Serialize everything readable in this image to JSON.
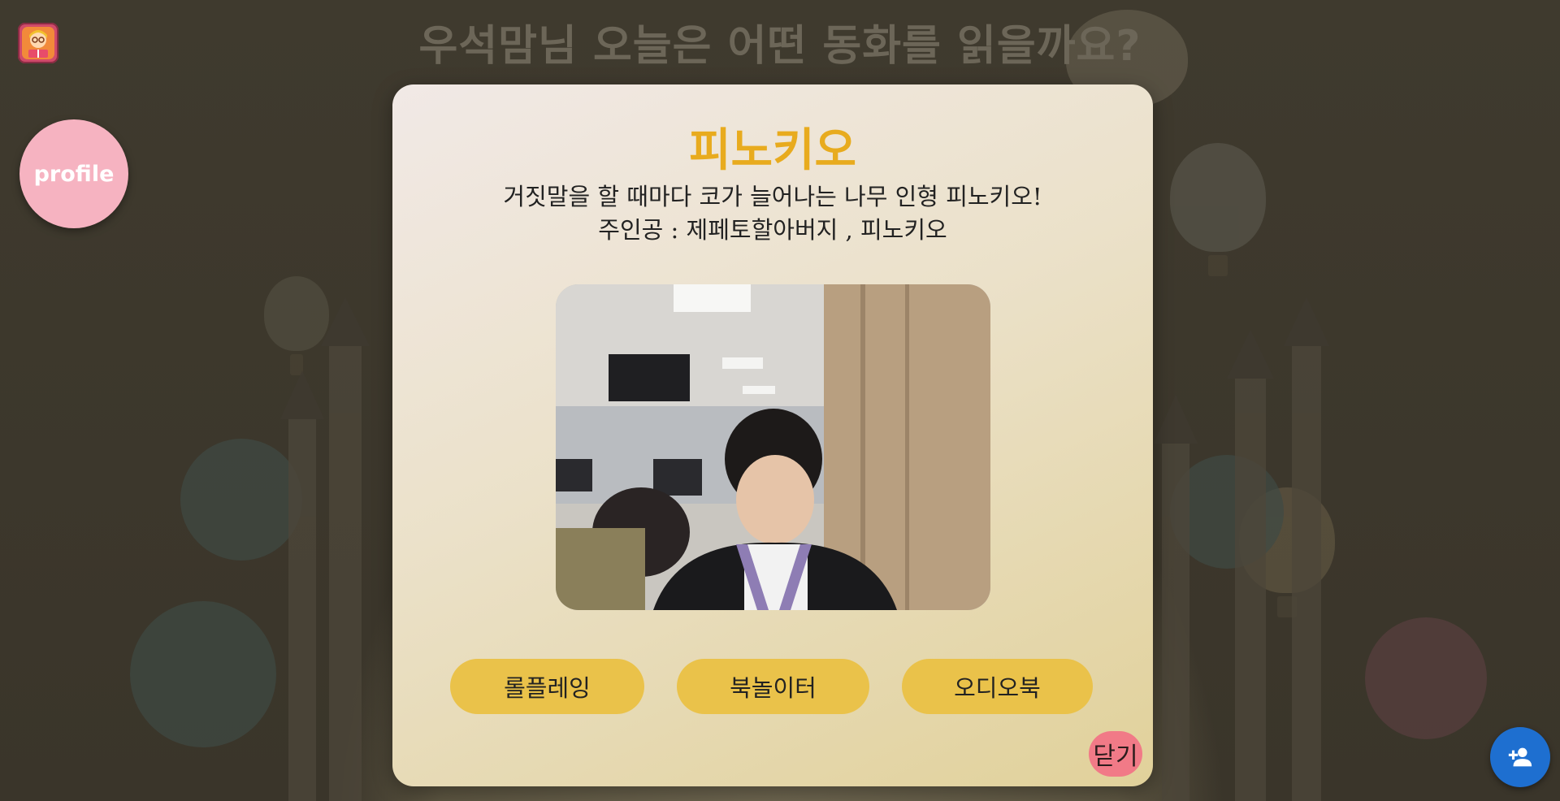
{
  "background": {
    "title": "우석맘님 오늘은 어떤 동화를 읽을까요?"
  },
  "sidebar": {
    "app_icon": "reading-girl-icon",
    "profile_label": "profile"
  },
  "modal": {
    "title": "피노키오",
    "description_line1": "거짓말을 할 때마다 코가 늘어나는 나무 인형 피노키오!",
    "description_line2": "주인공 : 제페토할아버지 , 피노키오",
    "buttons": [
      {
        "label": "롤플레잉"
      },
      {
        "label": "북놀이터"
      },
      {
        "label": "오디오북"
      }
    ],
    "close_label": "닫기"
  },
  "fab": {
    "icon": "add-person-icon"
  },
  "colors": {
    "title_accent": "#e8ab1e",
    "button_yellow": "#eac24a",
    "close_pink": "#f17a87",
    "profile_pink": "#f6b3c1",
    "fab_blue": "#1e6fd0"
  }
}
